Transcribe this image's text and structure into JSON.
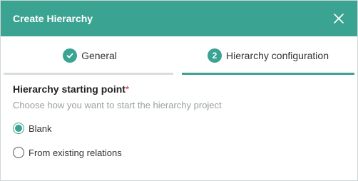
{
  "dialog": {
    "title": "Create Hierarchy",
    "close_icon": "close-icon"
  },
  "tabs": [
    {
      "label": "General",
      "icon": "check-icon",
      "state": "completed"
    },
    {
      "label": "Hierarchy configuration",
      "step": "2",
      "state": "active"
    }
  ],
  "field": {
    "label": "Hierarchy starting point",
    "required_marker": "*",
    "help": "Choose how you want to start the hierarchy project"
  },
  "options": [
    {
      "label": "Blank",
      "selected": true
    },
    {
      "label": "From existing relations",
      "selected": false
    }
  ],
  "colors": {
    "accent": "#3aa392",
    "required": "#d9363e"
  }
}
